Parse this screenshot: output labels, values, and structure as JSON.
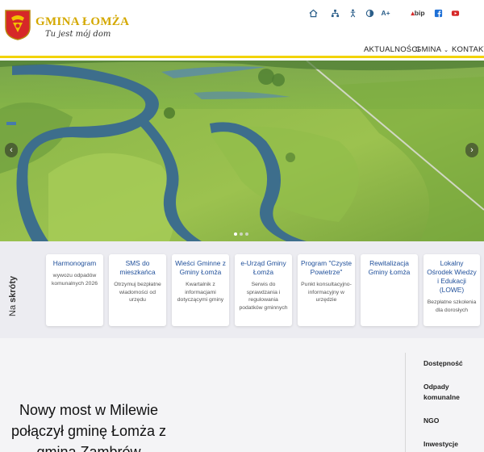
{
  "brand": {
    "name": "GMINA ŁOMŻA",
    "motto": "Tu jest mój dom"
  },
  "utility_icons": [
    "home-icon",
    "sitemap-icon",
    "accessibility-icon",
    "contrast-icon",
    "font-size-icon",
    "bip-icon",
    "facebook-icon",
    "youtube-icon"
  ],
  "utility": {
    "font_size_label": "A+",
    "bip_label": "bip"
  },
  "nav": {
    "items": [
      {
        "label": "AKTUALNOŚCI"
      },
      {
        "label": "GMINA",
        "caret": "⌄"
      },
      {
        "label": "KONTAKT"
      }
    ]
  },
  "hero": {
    "prev_icon": "‹",
    "next_icon": "›",
    "slide_count": 3,
    "active_slide": 1
  },
  "shortcuts": {
    "title_prefix": "Na ",
    "title_bold": "skróty",
    "cards": [
      {
        "title": "Harmonogram",
        "desc": "wywozu odpadów komunalnych 2026"
      },
      {
        "title": "SMS do mieszkańca",
        "desc": "Otrzymuj bezpłatne wiadomości od urzędu"
      },
      {
        "title": "Wieści Gminne z Gminy Łomża",
        "desc": "Kwartalnik z informacjami dotyczącymi gminy"
      },
      {
        "title": "e-Urząd Gminy Łomża",
        "desc": "Serwis do sprawdzania i regulowania podatków gminnych"
      },
      {
        "title": "Program \"Czyste Powietrze\"",
        "desc": "Punkt konsultacyjno-informacyjny w urzędzie"
      },
      {
        "title": "Rewitalizacja Gminy Łomża",
        "desc": ""
      },
      {
        "title": "Lokalny Ośrodek Wiedzy i Edukacji (LOWE)",
        "desc": "Bezpłatne szkolenia dla dorosłych"
      }
    ]
  },
  "article": {
    "title": "Nowy most w Milewie połączył gminę Łomża z gminą Zambrów"
  },
  "sidebar": {
    "links": [
      {
        "label": "Dostępność"
      },
      {
        "label": "Odpady komunalne"
      },
      {
        "label": "NGO"
      },
      {
        "label": "Inwestycje"
      }
    ]
  },
  "colors": {
    "accent_yellow": "#f2d300",
    "link_blue": "#1f4f9a",
    "brand_gold": "#d4a800"
  }
}
